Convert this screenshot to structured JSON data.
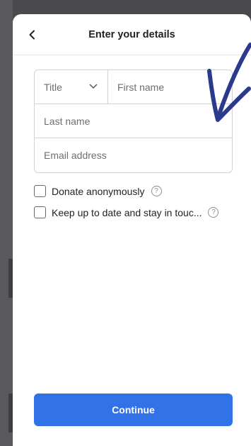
{
  "header": {
    "title": "Enter your details",
    "back_icon": "chevron-left-icon"
  },
  "form": {
    "title_select": {
      "placeholder": "Title",
      "icon": "chevron-down-icon"
    },
    "first_name": {
      "placeholder": "First name"
    },
    "last_name": {
      "placeholder": "Last name"
    },
    "email": {
      "placeholder": "Email address"
    }
  },
  "options": [
    {
      "label": "Donate anonymously",
      "checked": false,
      "help_icon": "help-circle-icon"
    },
    {
      "label": "Keep up to date and stay in touc...",
      "checked": false,
      "help_icon": "help-circle-icon"
    }
  ],
  "help_glyph": "?",
  "continue_label": "Continue",
  "colors": {
    "accent": "#3272e8",
    "annotation_arrow": "#2b3a8c"
  }
}
